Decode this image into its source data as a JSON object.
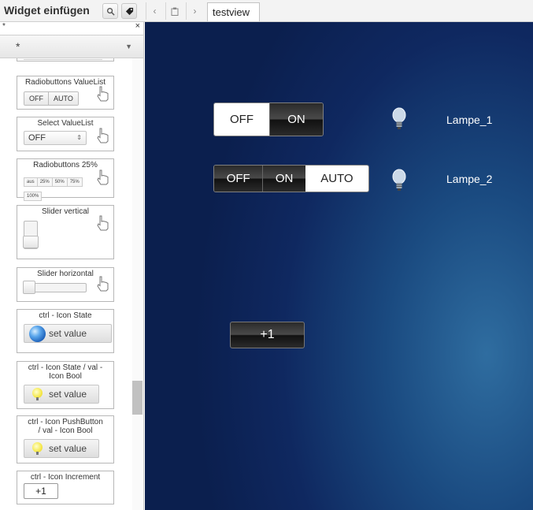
{
  "header": {
    "title": "Widget einfügen",
    "view_tab": "testview"
  },
  "sidebar": {
    "filter_text": "*",
    "filter_clear": "×",
    "filter_select_value": "*",
    "widgets": [
      {
        "title": "Radiobuttons ValueList",
        "options": [
          "OFF",
          "AUTO"
        ]
      },
      {
        "title": "Select ValueList",
        "value": "OFF"
      },
      {
        "title": "Radiobuttons 25%",
        "options": [
          "aus",
          "25%",
          "50%",
          "75%",
          "100%"
        ]
      },
      {
        "title": "Slider vertical"
      },
      {
        "title": "Slider horizontal"
      },
      {
        "title": "ctrl - Icon State",
        "button": "set value"
      },
      {
        "title_line1": "ctrl - Icon State / val -",
        "title_line2": "Icon Bool",
        "button": "set value"
      },
      {
        "title_line1": "ctrl - Icon PushButton",
        "title_line2": "/ val - Icon Bool",
        "button": "set value"
      },
      {
        "title": "ctrl - Icon Increment",
        "value": "+1"
      }
    ]
  },
  "canvas": {
    "lamp1": {
      "options": [
        "OFF",
        "ON"
      ],
      "selected": "ON",
      "label": "Lampe_1"
    },
    "lamp2": {
      "options": [
        "OFF",
        "ON",
        "AUTO"
      ],
      "selected": "AUTO",
      "label": "Lampe_2"
    },
    "increment_button": "+1"
  },
  "colors": {
    "canvas_dark": "#0b1f4e",
    "canvas_light": "#2f6da0",
    "active_button": "#2b2b2b"
  }
}
